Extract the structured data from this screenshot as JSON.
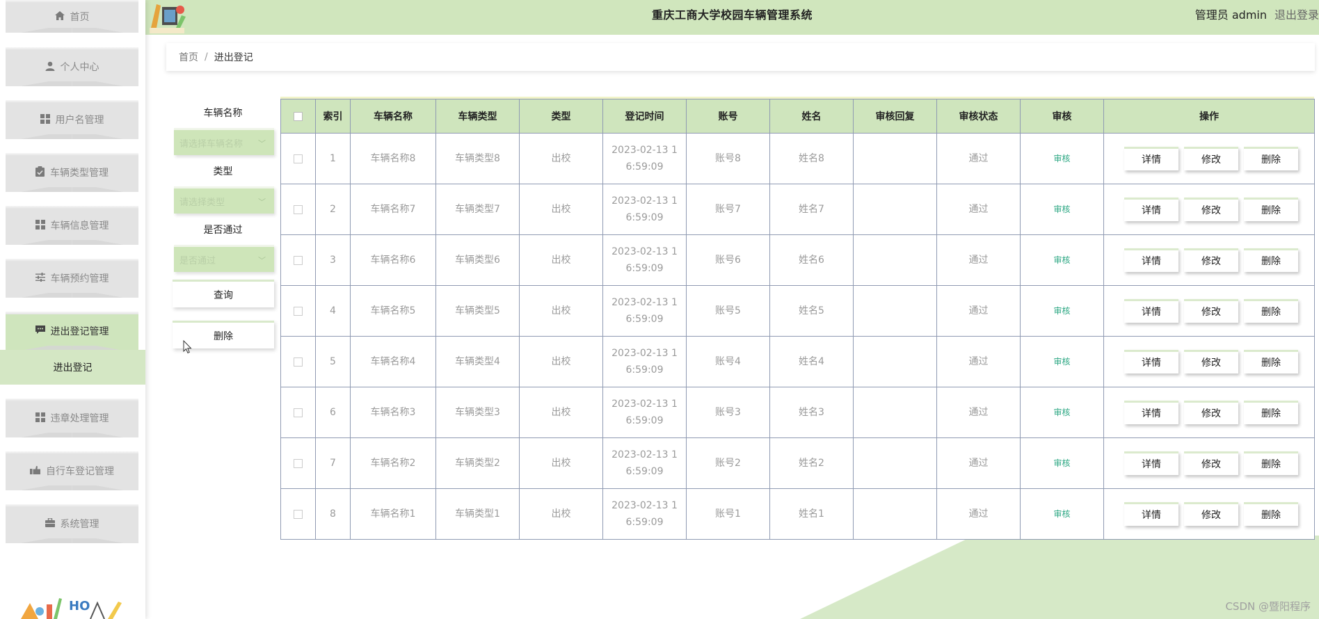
{
  "header": {
    "title": "重庆工商大学校园车辆管理系统",
    "user": "管理员 admin",
    "logout": "退出登录"
  },
  "sidebar": {
    "items": [
      {
        "label": "首页",
        "icon": "home-icon"
      },
      {
        "label": "个人中心",
        "icon": "user-icon"
      },
      {
        "label": "用户名管理",
        "icon": "grid-icon"
      },
      {
        "label": "车辆类型管理",
        "icon": "clipboard-icon"
      },
      {
        "label": "车辆信息管理",
        "icon": "grid-icon"
      },
      {
        "label": "车辆预约管理",
        "icon": "sliders-icon"
      },
      {
        "label": "进出登记管理",
        "icon": "chat-icon"
      },
      {
        "label": "违章处理管理",
        "icon": "grid-icon"
      },
      {
        "label": "自行车登记管理",
        "icon": "hand-icon"
      },
      {
        "label": "系统管理",
        "icon": "briefcase-icon"
      }
    ],
    "active_submenu": "进出登记"
  },
  "breadcrumb": {
    "home": "首页",
    "separator": "/",
    "current": "进出登记"
  },
  "filters": {
    "vehicle_name_label": "车辆名称",
    "vehicle_name_placeholder": "请选择车辆名称",
    "type_label": "类型",
    "type_placeholder": "请选择类型",
    "passed_label": "是否通过",
    "passed_placeholder": "是否通过",
    "query_button": "查询",
    "delete_button": "删除"
  },
  "table": {
    "columns": [
      "索引",
      "车辆名称",
      "车辆类型",
      "类型",
      "登记时间",
      "账号",
      "姓名",
      "审核回复",
      "审核状态",
      "审核",
      "操作"
    ],
    "rows": [
      {
        "index": "1",
        "name": "车辆名称8",
        "vtype": "车辆类型8",
        "type": "出校",
        "time_date": "2023-02-13 1",
        "time_clock": "6:59:09",
        "account": "账号8",
        "person": "姓名8",
        "reply": "",
        "status": "通过",
        "review": "审核"
      },
      {
        "index": "2",
        "name": "车辆名称7",
        "vtype": "车辆类型7",
        "type": "出校",
        "time_date": "2023-02-13 1",
        "time_clock": "6:59:09",
        "account": "账号7",
        "person": "姓名7",
        "reply": "",
        "status": "通过",
        "review": "审核"
      },
      {
        "index": "3",
        "name": "车辆名称6",
        "vtype": "车辆类型6",
        "type": "出校",
        "time_date": "2023-02-13 1",
        "time_clock": "6:59:09",
        "account": "账号6",
        "person": "姓名6",
        "reply": "",
        "status": "通过",
        "review": "审核"
      },
      {
        "index": "4",
        "name": "车辆名称5",
        "vtype": "车辆类型5",
        "type": "出校",
        "time_date": "2023-02-13 1",
        "time_clock": "6:59:09",
        "account": "账号5",
        "person": "姓名5",
        "reply": "",
        "status": "通过",
        "review": "审核"
      },
      {
        "index": "5",
        "name": "车辆名称4",
        "vtype": "车辆类型4",
        "type": "出校",
        "time_date": "2023-02-13 1",
        "time_clock": "6:59:09",
        "account": "账号4",
        "person": "姓名4",
        "reply": "",
        "status": "通过",
        "review": "审核"
      },
      {
        "index": "6",
        "name": "车辆名称3",
        "vtype": "车辆类型3",
        "type": "出校",
        "time_date": "2023-02-13 1",
        "time_clock": "6:59:09",
        "account": "账号3",
        "person": "姓名3",
        "reply": "",
        "status": "通过",
        "review": "审核"
      },
      {
        "index": "7",
        "name": "车辆名称2",
        "vtype": "车辆类型2",
        "type": "出校",
        "time_date": "2023-02-13 1",
        "time_clock": "6:59:09",
        "account": "账号2",
        "person": "姓名2",
        "reply": "",
        "status": "通过",
        "review": "审核"
      },
      {
        "index": "8",
        "name": "车辆名称1",
        "vtype": "车辆类型1",
        "type": "出校",
        "time_date": "2023-02-13 1",
        "time_clock": "6:59:09",
        "account": "账号1",
        "person": "姓名1",
        "reply": "",
        "status": "通过",
        "review": "审核"
      }
    ],
    "actions": {
      "detail": "详情",
      "edit": "修改",
      "delete": "删除"
    }
  },
  "watermark": "CSDN @暨阳程序",
  "colors": {
    "accent": "#cfe5bd",
    "menu_bg": "#e3e3e3",
    "review_link": "#2ca783",
    "table_border": "#8f9ab2"
  }
}
